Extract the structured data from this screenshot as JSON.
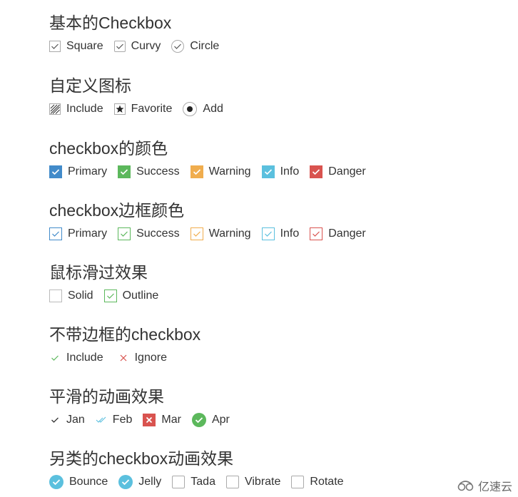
{
  "colors": {
    "primary": "#428bca",
    "success": "#5cb85c",
    "warning": "#f0ad4e",
    "info": "#5bc0de",
    "danger": "#d9534f",
    "neutral_border": "#aaaaaa",
    "text": "#333333"
  },
  "sections": [
    {
      "title": "基本的Checkbox",
      "items": [
        {
          "label": "Square",
          "checked": true,
          "shape": "square"
        },
        {
          "label": "Curvy",
          "checked": true,
          "shape": "curvy"
        },
        {
          "label": "Circle",
          "checked": true,
          "shape": "circle"
        }
      ]
    },
    {
      "title": "自定义图标",
      "items": [
        {
          "label": "Include",
          "checked": true,
          "icon": "hatch-icon"
        },
        {
          "label": "Favorite",
          "checked": true,
          "icon": "star-icon"
        },
        {
          "label": "Add",
          "checked": true,
          "icon": "dot-icon"
        }
      ]
    },
    {
      "title": "checkbox的颜色",
      "items": [
        {
          "label": "Primary",
          "checked": true,
          "color": "primary"
        },
        {
          "label": "Success",
          "checked": true,
          "color": "success"
        },
        {
          "label": "Warning",
          "checked": true,
          "color": "warning"
        },
        {
          "label": "Info",
          "checked": true,
          "color": "info"
        },
        {
          "label": "Danger",
          "checked": true,
          "color": "danger"
        }
      ]
    },
    {
      "title": "checkbox边框颜色",
      "items": [
        {
          "label": "Primary",
          "checked": true,
          "color": "primary"
        },
        {
          "label": "Success",
          "checked": true,
          "color": "success"
        },
        {
          "label": "Warning",
          "checked": true,
          "color": "warning"
        },
        {
          "label": "Info",
          "checked": true,
          "color": "info"
        },
        {
          "label": "Danger",
          "checked": true,
          "color": "danger"
        }
      ]
    },
    {
      "title": "鼠标滑过效果",
      "items": [
        {
          "label": "Solid",
          "checked": false
        },
        {
          "label": "Outline",
          "checked": true,
          "color": "success"
        }
      ]
    },
    {
      "title": "不带边框的checkbox",
      "items": [
        {
          "label": "Include",
          "checked": true,
          "icon": "check-icon",
          "color": "success"
        },
        {
          "label": "Ignore",
          "checked": true,
          "icon": "cross-icon",
          "color": "danger"
        }
      ]
    },
    {
      "title": "平滑的动画效果",
      "items": [
        {
          "label": "Jan",
          "checked": true,
          "icon": "check-icon"
        },
        {
          "label": "Feb",
          "checked": true,
          "icon": "double-check-icon",
          "color": "info"
        },
        {
          "label": "Mar",
          "checked": true,
          "icon": "cross-icon",
          "color": "danger"
        },
        {
          "label": "Apr",
          "checked": true,
          "icon": "check-circle-icon",
          "color": "success"
        }
      ]
    },
    {
      "title": "另类的checkbox动画效果",
      "items": [
        {
          "label": "Bounce",
          "checked": true,
          "color": "info"
        },
        {
          "label": "Jelly",
          "checked": true,
          "color": "info"
        },
        {
          "label": "Tada",
          "checked": false
        },
        {
          "label": "Vibrate",
          "checked": false
        },
        {
          "label": "Rotate",
          "checked": false
        }
      ]
    }
  ],
  "watermark": {
    "text": "亿速云"
  }
}
